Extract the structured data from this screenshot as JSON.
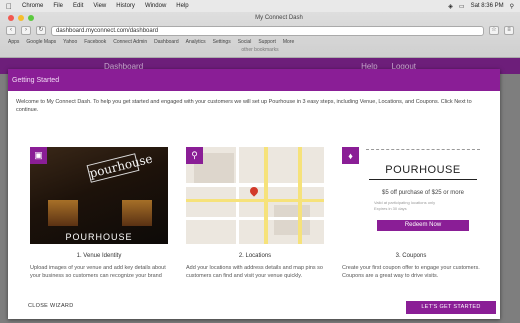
{
  "menubar": {
    "apple": "",
    "items": [
      "Chrome",
      "File",
      "Edit",
      "View",
      "History",
      "Window",
      "Help"
    ],
    "right": "Sat 8:36 PM"
  },
  "browser": {
    "tab_title": "My Connect Dash",
    "address": "dashboard.myconnect.com/dashboard",
    "bookmarks": [
      "Apps",
      "Google Maps",
      "Yahoo",
      "Facebook",
      "Connect Admin",
      "Dashboard",
      "Analytics",
      "Settings",
      "Social",
      "Support",
      "More"
    ],
    "status": "other bookmarks"
  },
  "app": {
    "brand": "Dashboard",
    "right_link": "Help",
    "right_link2": "Logout"
  },
  "modal": {
    "title": "Getting Started",
    "intro": "Welcome to My Connect Dash. To help you get started and engaged with your customers we will set up Pourhouse in 3 easy steps, including Venue, Locations, and Coupons. Click Next to continue.",
    "cards": [
      {
        "caption": "1. Venue Identity",
        "desc": "Upload images of your venue and add key details about your business so customers can recognize your brand and build trust.",
        "image": {
          "sign": "pourhouse",
          "name": "POURHOUSE"
        }
      },
      {
        "caption": "2. Locations",
        "desc": "Add your locations with address details and map pins so customers can find and visit your venue quickly.",
        "image": {}
      },
      {
        "caption": "3. Coupons",
        "desc": "Create your first coupon offer to engage your customers. Coupons are a great way to drive visits.",
        "coupon": {
          "brand": "POURHOUSE",
          "offer": "$5 off purchase of $25 or more",
          "fine_print": [
            "Valid at participating locations only",
            "Expires in 30 days"
          ],
          "redeem": "Redeem Now"
        }
      }
    ],
    "close_label": "CLOSE WIZARD",
    "cta_label": "LET'S GET STARTED"
  },
  "colors": {
    "accent": "#8a1e96",
    "appbar": "#6d1e7a"
  }
}
